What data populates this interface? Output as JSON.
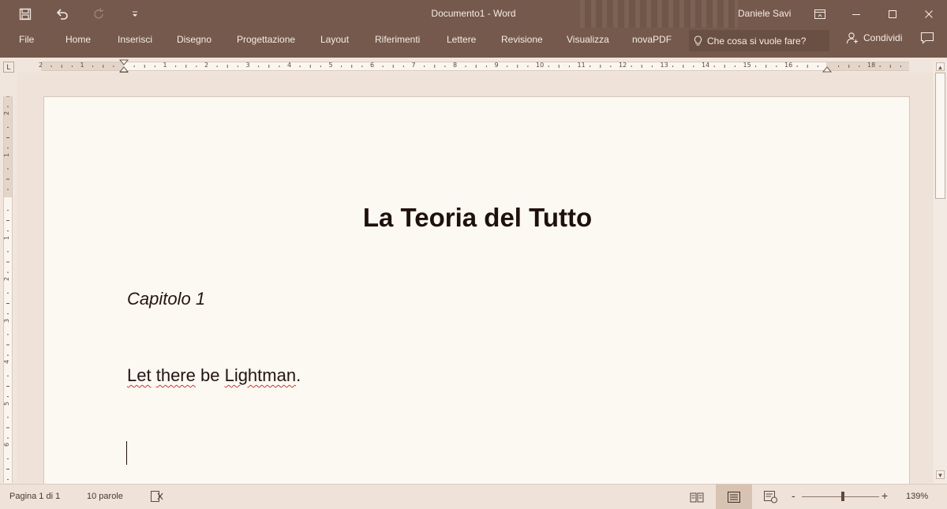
{
  "window": {
    "title": "Documento1 - Word",
    "user": "Daniele Savi"
  },
  "quick_access": {
    "icons": [
      "save-icon",
      "undo-icon",
      "redo-icon",
      "customize-qat-icon"
    ]
  },
  "ribbon": {
    "tabs": [
      {
        "label": "File"
      },
      {
        "label": "Home"
      },
      {
        "label": "Inserisci"
      },
      {
        "label": "Disegno"
      },
      {
        "label": "Progettazione"
      },
      {
        "label": "Layout"
      },
      {
        "label": "Riferimenti"
      },
      {
        "label": "Lettere"
      },
      {
        "label": "Revisione"
      },
      {
        "label": "Visualizza"
      },
      {
        "label": "novaPDF"
      }
    ],
    "tell_me": "Che cosa si vuole fare?",
    "share": "Condividi"
  },
  "ruler": {
    "horizontal_numbers": [
      "2",
      "1",
      "1",
      "2",
      "3",
      "4",
      "5",
      "6",
      "7",
      "8",
      "9",
      "10",
      "11",
      "12",
      "13",
      "14",
      "15",
      "16",
      "18"
    ],
    "vertical_numbers": [
      "2",
      "1",
      "1",
      "2",
      "3",
      "4",
      "5",
      "6"
    ],
    "tab_selector": "L"
  },
  "document": {
    "heading": "La Teoria del Tutto",
    "chapter": "Capitolo 1",
    "body_parts": [
      "Let",
      " ",
      "there",
      " be ",
      "Lightman",
      "."
    ]
  },
  "statusbar": {
    "page": "Pagina 1 di 1",
    "words": "10 parole",
    "zoom": "139%",
    "zoom_minus": "-",
    "zoom_plus": "+"
  },
  "colors": {
    "titlebar": "#75594c",
    "page": "#fcf8f2",
    "spellcheck": "#c13c3c"
  }
}
